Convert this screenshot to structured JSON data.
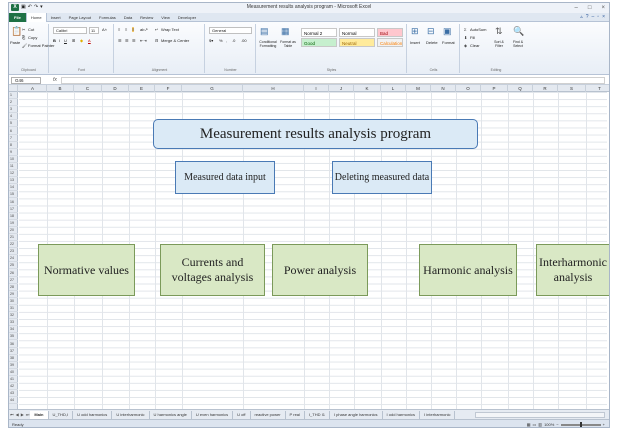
{
  "window": {
    "title": "Measurement results analysis program - Microsoft Excel",
    "logo": "X"
  },
  "ribbon_tabs": [
    "File",
    "Home",
    "Insert",
    "Page Layout",
    "Formulas",
    "Data",
    "Review",
    "View",
    "Developer"
  ],
  "ribbon": {
    "clipboard": {
      "label": "Clipboard",
      "paste": "Paste",
      "cut": "Cut",
      "copy": "Copy",
      "format_painter": "Format Painter"
    },
    "font": {
      "label": "Font",
      "name": "Calibri",
      "size": "11"
    },
    "alignment": {
      "label": "Alignment",
      "wrap": "Wrap Text",
      "merge": "Merge & Center"
    },
    "number": {
      "label": "Number",
      "format": "General"
    },
    "styles": {
      "label": "Styles",
      "conditional": "Conditional Formatting",
      "format_as_table": "Format as Table",
      "cells": [
        {
          "name": "Normal 2",
          "bg": "#ffffff",
          "fg": "#000000"
        },
        {
          "name": "Normal",
          "bg": "#ffffff",
          "fg": "#000000"
        },
        {
          "name": "Bad",
          "bg": "#ffc7ce",
          "fg": "#9c0006"
        },
        {
          "name": "Good",
          "bg": "#c6efce",
          "fg": "#006100"
        },
        {
          "name": "Neutral",
          "bg": "#ffeb9c",
          "fg": "#9c6500"
        },
        {
          "name": "Calculation",
          "bg": "#f2f2f2",
          "fg": "#fa7d00"
        }
      ]
    },
    "cells": {
      "label": "Cells",
      "insert": "Insert",
      "delete": "Delete",
      "format": "Format"
    },
    "editing": {
      "label": "Editing",
      "autosum": "AutoSum",
      "fill": "Fill",
      "clear": "Clear",
      "sort": "Sort & Filter",
      "find": "Find & Select"
    }
  },
  "formula_bar": {
    "cell_ref": "G46",
    "fx": "fx",
    "value": ""
  },
  "columns": [
    "A",
    "B",
    "C",
    "D",
    "E",
    "F",
    "G",
    "H",
    "I",
    "J",
    "K",
    "L",
    "M",
    "N",
    "O",
    "P",
    "Q",
    "R",
    "S",
    "T",
    "U"
  ],
  "rows": [
    "1",
    "2",
    "3",
    "4",
    "5",
    "6",
    "7",
    "8",
    "9",
    "10",
    "11",
    "12",
    "13",
    "14",
    "15",
    "16",
    "17",
    "18",
    "19",
    "20",
    "21",
    "22",
    "23",
    "24",
    "25",
    "26",
    "27",
    "28",
    "29",
    "30",
    "31",
    "32",
    "33",
    "34",
    "35",
    "36",
    "37",
    "38",
    "39",
    "40",
    "41",
    "42",
    "43",
    "44"
  ],
  "shapes": {
    "title": "Measurement results analysis program",
    "measured_input": "Measured data input",
    "deleting": "Deleting measured data",
    "normative": "Normative values",
    "currents": "Currents and voltages analysis",
    "power": "Power analysis",
    "harmonic": "Harmonic analysis",
    "interharmonic": "Interharmonic analysis"
  },
  "sheet_tabs": [
    "Main",
    "U_THD,I",
    "U odd harmonics",
    "U interharmonic",
    "U harmonics angle",
    "U even harmonics",
    "U off",
    "reactive power",
    "P real",
    "I_THD I1",
    "I phase angle harmonics",
    "I odd harmonics",
    "I interharmonic"
  ],
  "status": {
    "text": "Ready",
    "zoom": "100%"
  }
}
